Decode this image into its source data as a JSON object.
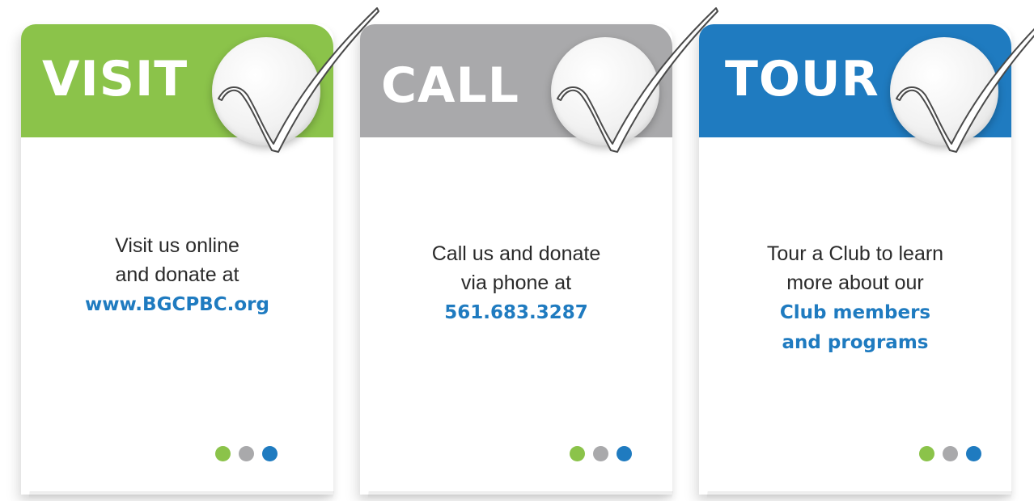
{
  "colors": {
    "green": "#8bc34a",
    "gray": "#a9a9ab",
    "blue": "#1f7bc0",
    "text": "#2a2a2a"
  },
  "cards": [
    {
      "title": "VISIT",
      "header_color": "#8bc34a",
      "icon": "checkmark-icon",
      "lines": [
        "Visit us online",
        "and donate at"
      ],
      "highlight": [
        "www.BGCPBC.org"
      ],
      "dots": [
        "#8bc34a",
        "#a9a9ab",
        "#1f7bc0"
      ]
    },
    {
      "title": "CALL",
      "header_color": "#a9a9ab",
      "icon": "checkmark-icon",
      "lines": [
        "Call us and donate",
        "via phone at"
      ],
      "highlight": [
        "561.683.3287"
      ],
      "dots": [
        "#8bc34a",
        "#a9a9ab",
        "#1f7bc0"
      ]
    },
    {
      "title": "TOUR",
      "header_color": "#1f7bc0",
      "icon": "checkmark-icon",
      "lines": [
        "Tour a Club to learn",
        "more about our"
      ],
      "highlight": [
        "Club members",
        "and programs"
      ],
      "dots": [
        "#8bc34a",
        "#a9a9ab",
        "#1f7bc0"
      ]
    }
  ]
}
